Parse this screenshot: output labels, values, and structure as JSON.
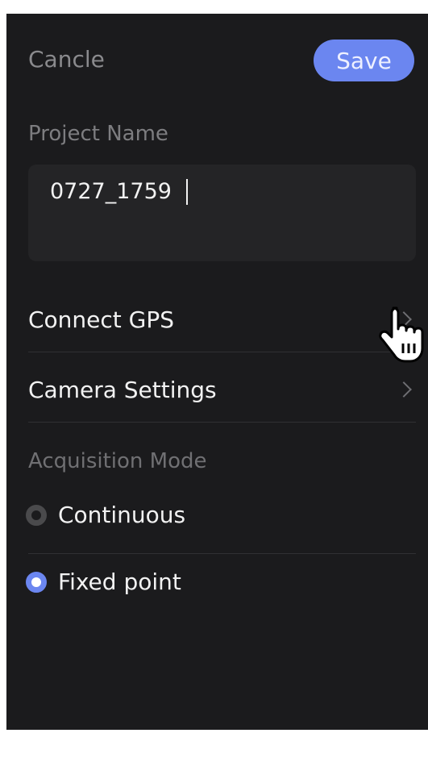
{
  "header": {
    "cancel_label": "Cancle",
    "save_label": "Save"
  },
  "project": {
    "label": "Project Name",
    "value": "0727_1759"
  },
  "menu": {
    "connect_gps": "Connect GPS",
    "camera_settings": "Camera Settings"
  },
  "acquisition": {
    "label": "Acquisition Mode",
    "options": [
      {
        "label": "Continuous",
        "selected": false
      },
      {
        "label": "Fixed point",
        "selected": true
      }
    ]
  },
  "colors": {
    "background": "#1b1b1d",
    "accent": "#6b86f0",
    "text": "#f2f2f2",
    "muted": "#7d7d80"
  },
  "icons": [
    "chevron-right-icon",
    "radio-icon",
    "hand-pointer-icon"
  ]
}
